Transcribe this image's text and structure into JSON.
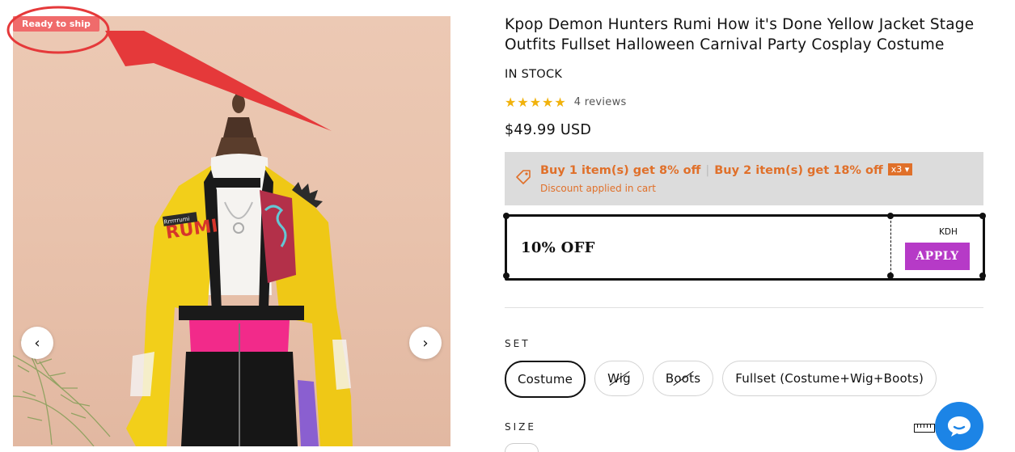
{
  "gallery": {
    "badge": "Ready to ship",
    "prev_icon": "chevron-left-icon",
    "next_icon": "chevron-right-icon",
    "prev_glyph": "‹",
    "next_glyph": "›",
    "jacket_patch_text": "RUMI",
    "jacket_tag_text": "Rrrrrrumi"
  },
  "product": {
    "title": "Kpop Demon Hunters Rumi How it's Done Yellow Jacket Stage Outfits Fullset Halloween Carnival Party Cosplay Costume",
    "stock": "IN STOCK",
    "rating_stars": 5,
    "reviews": "4 reviews",
    "price": "$49.99 USD"
  },
  "promo": {
    "offer1": "Buy 1 item(s) get 8% off",
    "separator": "|",
    "offer2": "Buy 2 item(s) get 18% off",
    "qty_badge": "x3",
    "note": "Discount applied in cart",
    "icon": "tag-icon"
  },
  "coupon": {
    "text": "10% OFF",
    "code": "KDH",
    "apply_label": "APPLY"
  },
  "options": {
    "set_label": "SET",
    "set_values": [
      "Costume",
      "Wig",
      "Boots",
      "Fullset (Costume+Wig+Boots)"
    ],
    "selected": "Costume",
    "unavailable": [
      "Wig",
      "Boots"
    ],
    "size_label": "SIZE",
    "size_chart_icon": "ruler-icon"
  },
  "chat": {
    "icon": "chat-bubble-icon"
  },
  "colors": {
    "accent_orange": "#e0702a",
    "apply_purple": "#b63ac7",
    "chat_blue": "#1c84e6",
    "badge_red": "#f06b6b",
    "star_gold": "#f1b20c",
    "annotation_red": "#e5393a"
  }
}
